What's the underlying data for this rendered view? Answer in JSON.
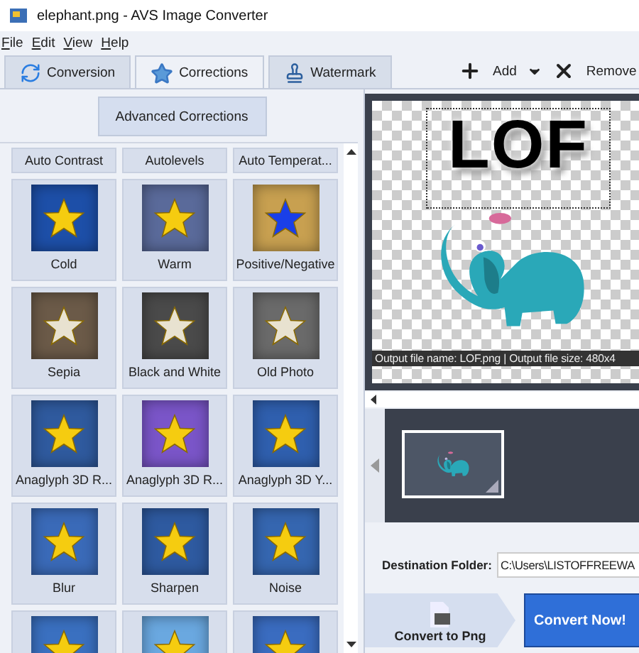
{
  "window": {
    "title": "elephant.png - AVS Image Converter"
  },
  "menu": [
    "File",
    "Edit",
    "View",
    "Help"
  ],
  "tabs": [
    {
      "label": "Conversion",
      "kind": "conversion",
      "selected": false
    },
    {
      "label": "Corrections",
      "kind": "corrections",
      "selected": true
    },
    {
      "label": "Watermark",
      "kind": "watermark",
      "selected": false
    }
  ],
  "toolbar": {
    "add": "Add",
    "remove": "Remove"
  },
  "advanced_button": "Advanced Corrections",
  "auto_buttons": [
    "Auto Contrast",
    "Autolevels",
    "Auto Temperat..."
  ],
  "effects": [
    {
      "label": "Cold",
      "color": "#1d4fa8"
    },
    {
      "label": "Warm",
      "color": "#5a6a9a"
    },
    {
      "label": "Positive/Negative",
      "color": "#c8a050"
    },
    {
      "label": "Sepia",
      "color": "#6b5a48"
    },
    {
      "label": "Black and White",
      "color": "#4a4a4a"
    },
    {
      "label": "Old Photo",
      "color": "#6a6a6a"
    },
    {
      "label": "Anaglyph 3D R...",
      "color": "#2f5a9e"
    },
    {
      "label": "Anaglyph 3D R...",
      "color": "#7a55c8"
    },
    {
      "label": "Anaglyph 3D Y...",
      "color": "#2f5fae"
    },
    {
      "label": "Blur",
      "color": "#3a6ab8"
    },
    {
      "label": "Sharpen",
      "color": "#2e5aa0"
    },
    {
      "label": "Noise",
      "color": "#3566b0"
    },
    {
      "color": "#3a70c0"
    },
    {
      "color": "#6aa8e0"
    },
    {
      "color": "#3a6cc0"
    }
  ],
  "preview": {
    "logo": "LOF",
    "caption": "Output file name: LOF.png | Output file size: 480x4"
  },
  "destination": {
    "label": "Destination Folder:",
    "value": "C:\\Users\\LISTOFFREEWA"
  },
  "convert_format": "Convert to Png",
  "convert_now": "Convert Now!"
}
